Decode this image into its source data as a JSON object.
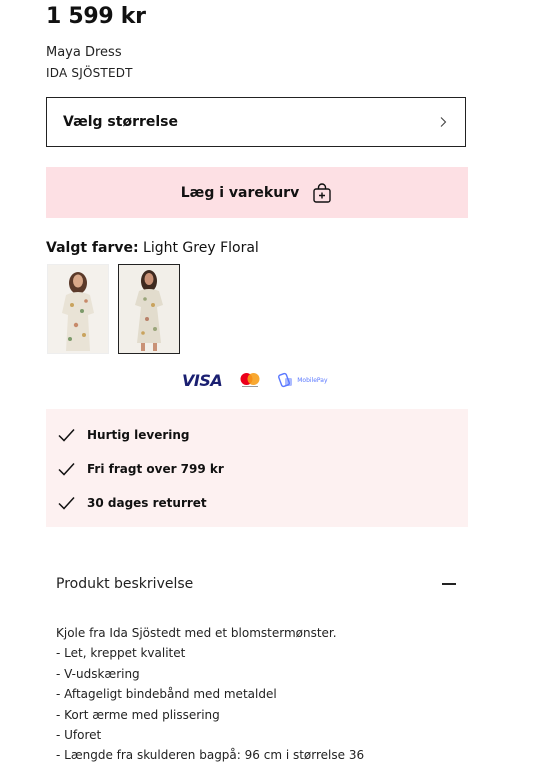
{
  "product": {
    "price": "1 599 kr",
    "name": "Maya Dress",
    "brand": "IDA SJÖSTEDT"
  },
  "size_selector": {
    "label": "Vælg størrelse",
    "icon": "chevron-right-icon"
  },
  "cart_button": {
    "label": "Læg i varekurv",
    "icon": "shopping-bag-plus-icon"
  },
  "color": {
    "label": "Valgt farve:",
    "value": "Light Grey Floral"
  },
  "color_swatches": [
    {
      "name": "floral-dress-variant-1"
    },
    {
      "name": "floral-dress-variant-2",
      "selected": true
    }
  ],
  "payments": {
    "visa": "VISA",
    "mobilepay": "MobilePay"
  },
  "usps": [
    {
      "text": "Hurtig levering",
      "icon": "check-icon"
    },
    {
      "text": "Fri fragt over 799 kr",
      "icon": "check-icon"
    },
    {
      "text": "30 dages returret",
      "icon": "check-icon"
    }
  ],
  "description": {
    "title": "Produkt beskrivelse",
    "icon": "minus-icon",
    "lines": [
      "Kjole fra Ida Sjöstedt med et blomstermønster.",
      "- Let, kreppet kvalitet",
      "- V-udskæring",
      "- Aftageligt bindebånd med metaldel",
      "- Kort ærme med plissering",
      "- Uforet",
      "- Længde fra skulderen bagpå: 96 cm i størrelse 36"
    ]
  },
  "colors": {
    "cart_bg": "#fde0e4",
    "usp_bg": "#fdf1f1",
    "visa": "#1a1f71",
    "mastercard_red": "#eb001b",
    "mastercard_orange": "#f79e1b",
    "mobilepay": "#5a78ff"
  }
}
